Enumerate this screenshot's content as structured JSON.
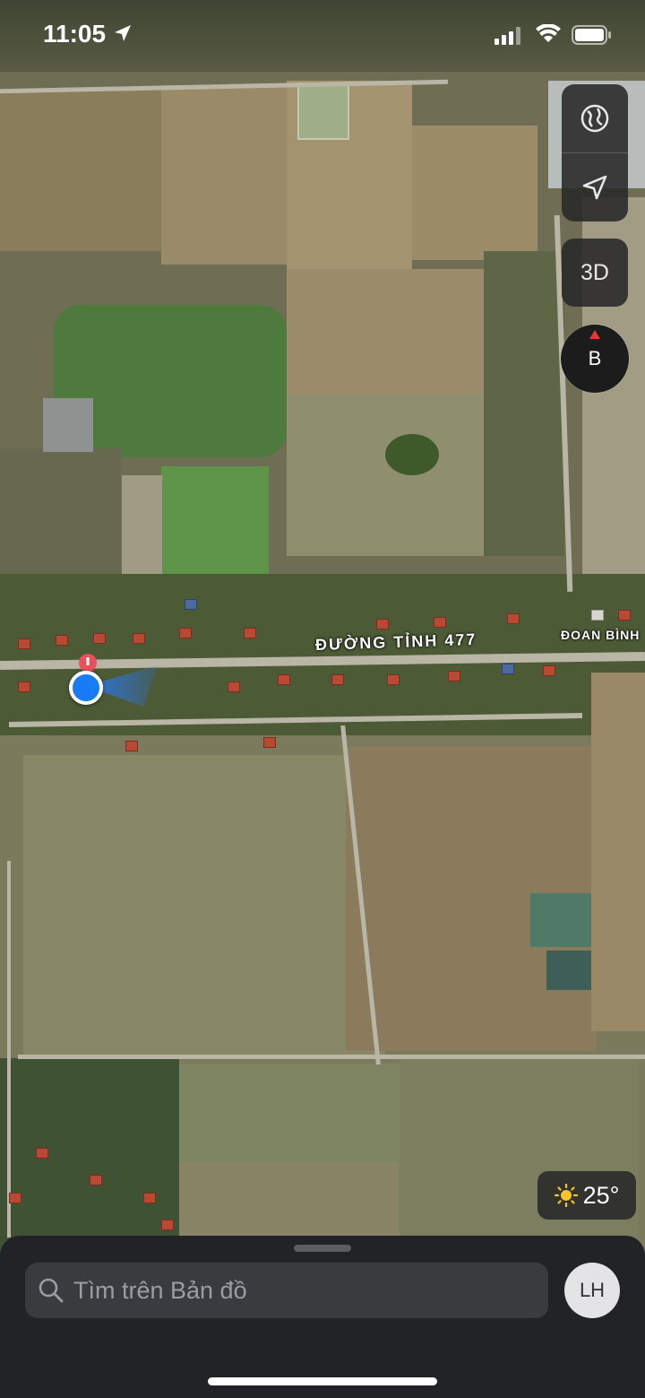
{
  "status_bar": {
    "time": "11:05"
  },
  "map": {
    "road_label": "ĐƯỜNG TỈNH 477",
    "place_label": "ĐOAN BÌNH",
    "mode_button": "3D",
    "compass_label": "B"
  },
  "weather": {
    "temperature": "25°",
    "icon": "sun-icon"
  },
  "search": {
    "placeholder": "Tìm trên Bản đồ"
  },
  "account": {
    "initials": "LH"
  },
  "colors": {
    "user_location": "#1a7cf5",
    "compass_needle": "#e53935",
    "sheet_background": "#222326",
    "search_field": "#3a3b3f"
  }
}
